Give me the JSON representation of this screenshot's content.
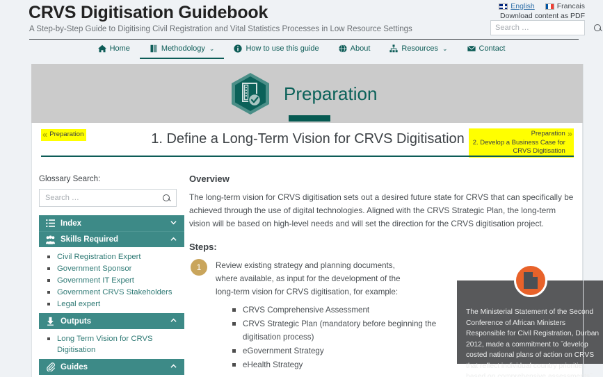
{
  "site": {
    "title": "CRVS Digitisation Guidebook",
    "tagline": "A Step-by-Step Guide to Digitising Civil Registration and Vital Statistics Processes in Low Resource Settings",
    "download_pdf": "Download content as PDF"
  },
  "languages": [
    {
      "label": "English",
      "icon": "uk-flag-icon",
      "active": true
    },
    {
      "label": "Francais",
      "icon": "fr-flag-icon",
      "active": false
    }
  ],
  "header_search": {
    "placeholder": "Search …",
    "value": "",
    "icon": "search-icon"
  },
  "nav": {
    "items": [
      {
        "label": "Home",
        "icon": "home-icon",
        "caret": "",
        "active": false
      },
      {
        "label": "Methodology",
        "icon": "book-icon",
        "caret": "⌄",
        "active": true
      },
      {
        "label": "How to use this guide",
        "icon": "info-icon",
        "caret": "",
        "active": false
      },
      {
        "label": "About",
        "icon": "globe-icon",
        "caret": "",
        "active": false
      },
      {
        "label": "Resources",
        "icon": "sitemap-icon",
        "caret": "⌄",
        "active": false
      },
      {
        "label": "Contact",
        "icon": "envelope-icon",
        "caret": "",
        "active": false
      }
    ]
  },
  "banner": {
    "title": "Preparation",
    "icon": "hexagon-checklist-icon"
  },
  "pager": {
    "prev": {
      "label": "Preparation",
      "chevron": "«"
    },
    "next": {
      "line1": "Preparation",
      "line2": "2. Develop a Business Case for CRVS Digitisation",
      "chevron": "»"
    }
  },
  "page_title": "1. Define a Long-Term Vision for CRVS Digitisation",
  "sidebar": {
    "glossary_label": "Glossary Search:",
    "glossary_search": {
      "placeholder": "Search …",
      "value": "",
      "icon": "search-icon"
    },
    "sections": [
      {
        "label": "Index",
        "icon": "list-icon",
        "caret": "down",
        "expanded": false,
        "items": []
      },
      {
        "label": "Skills Required",
        "icon": "people-icon",
        "caret": "up",
        "expanded": true,
        "items": [
          "Civil Registration Expert",
          "Government Sponsor",
          "Government IT Expert",
          "Government CRVS Stakeholders",
          "Legal expert"
        ]
      },
      {
        "label": "Outputs",
        "icon": "output-icon",
        "caret": "up",
        "expanded": true,
        "items": [
          "Long Term Vision for CRVS Digitisation"
        ]
      },
      {
        "label": "Guides",
        "icon": "paperclip-icon",
        "caret": "up",
        "expanded": true,
        "items": []
      }
    ]
  },
  "main": {
    "overview_heading": "Overview",
    "overview_text": "The long-term vision for CRVS digitisation sets out a desired future state for CRVS that can specifically be achieved through the use of digital technologies. Aligned with the CRVS Strategic Plan, the long-term vision will be based on high-level needs and will set the direction for the CRVS digitisation project.",
    "steps_heading": "Steps:",
    "steps": [
      {
        "number": "1",
        "text": "Review existing strategy and planning documents, where available, as input for the development of the long-term vision for CRVS digitisation, for example:",
        "sub_items": [
          "CRVS Comprehensive Assessment",
          "CRVS Strategic Plan (mandatory before beginning the digitisation process)",
          "eGovernment Strategy",
          "eHealth Strategy"
        ]
      }
    ],
    "callout": {
      "icon": "document-icon",
      "text": "The Ministerial Statement of the Second Conference of African Ministers Responsible for Civil Registration, Durban 2012, made a commitment to ˝develop costed national plans of action on CRVS that reflect individual country priorities based on comprehensive assessments˝"
    }
  },
  "colors": {
    "teal_dark": "#0d5c57",
    "teal_banner_title": "#0b6159",
    "teal_sidebar": "#3d8a87",
    "gray_banner": "#cbcbcb",
    "highlight_yellow": "#ffff00",
    "step_gold": "#c9a55c",
    "callout_gray": "#58595b",
    "callout_orange": "#e8622a",
    "link_blue": "#2f6fa8",
    "page_bg": "#eff2f5"
  }
}
